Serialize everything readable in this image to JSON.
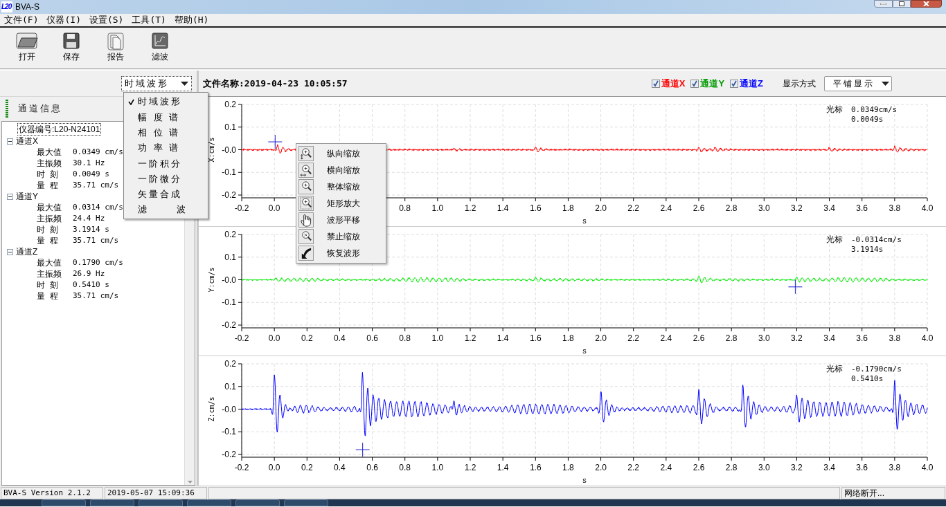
{
  "window": {
    "title": "BVA-S",
    "app_icon_text": "L20"
  },
  "menu": [
    "文件(F)",
    "仪器(I)",
    "设置(S)",
    "工具(T)",
    "帮助(H)"
  ],
  "toolbar": [
    {
      "label": "打开",
      "kind": "open"
    },
    {
      "label": "保存",
      "kind": "save"
    },
    {
      "label": "报告",
      "kind": "report"
    },
    {
      "label": "滤波",
      "kind": "filter"
    }
  ],
  "view_select": {
    "value": "时域波形"
  },
  "view_menu": [
    {
      "label": "时域波形",
      "selected": true
    },
    {
      "label": "幅 度 谱",
      "selected": false
    },
    {
      "label": "相 位 谱",
      "selected": false
    },
    {
      "label": "功 率 谱",
      "selected": false
    },
    {
      "label": "一阶积分",
      "selected": false
    },
    {
      "label": "一阶微分",
      "selected": false
    },
    {
      "label": "矢量合成",
      "selected": false
    },
    {
      "label": "滤      波",
      "selected": false
    }
  ],
  "channel_info": {
    "title": "通道信息",
    "device_id": {
      "label": "仪器编号:L20-N24101",
      "selected": true
    },
    "channels": [
      {
        "label": "通道X",
        "expanded": true,
        "children": [
          {
            "label": "最大值",
            "value": "0.0349 cm/s"
          },
          {
            "label": "主振频",
            "value": "30.1 Hz"
          },
          {
            "label": "时  刻",
            "value": "0.0049 s"
          },
          {
            "label": "量  程",
            "value": "35.71 cm/s"
          }
        ]
      },
      {
        "label": "通道Y",
        "expanded": true,
        "children": [
          {
            "label": "最大值",
            "value": "0.0314 cm/s"
          },
          {
            "label": "主振频",
            "value": "24.4 Hz"
          },
          {
            "label": "时  刻",
            "value": "3.1914 s"
          },
          {
            "label": "量  程",
            "value": "35.71 cm/s"
          }
        ]
      },
      {
        "label": "通道Z",
        "expanded": true,
        "children": [
          {
            "label": "最大值",
            "value": "0.1790 cm/s"
          },
          {
            "label": "主振频",
            "value": "26.9 Hz"
          },
          {
            "label": "时  刻",
            "value": "0.5410 s"
          },
          {
            "label": "量  程",
            "value": "35.71 cm/s"
          }
        ]
      }
    ]
  },
  "file_name": "文件名称:2019-04-23 10:05:57",
  "channel_toggles": [
    {
      "label": "通道X",
      "checked": true,
      "color": "#ff0000"
    },
    {
      "label": "通道Y",
      "checked": true,
      "color": "#009900"
    },
    {
      "label": "通道Z",
      "checked": true,
      "color": "#0000ff"
    }
  ],
  "display_mode": {
    "label": "显示方式",
    "value": "平铺显示"
  },
  "charts": [
    {
      "ylabel": "X:cm/s",
      "xlabel": "s",
      "color": "#ff0000",
      "cursor": {
        "label": "光标",
        "value": "0.0349cm/s",
        "time": "0.0049s"
      },
      "y_tick_labels": [
        "0.2",
        "0.1",
        "-0.0",
        "-0.1",
        "-0.2"
      ],
      "x_tick_labels": [
        "-0.2",
        "0.0",
        "0.8",
        "1.0",
        "1.2",
        "1.4",
        "1.6",
        "1.8",
        "2.0",
        "2.2",
        "2.4",
        "2.6",
        "2.8",
        "3.0",
        "3.2",
        "3.4",
        "3.6",
        "3.8",
        "4.0"
      ]
    },
    {
      "ylabel": "Y:cm/s",
      "xlabel": "s",
      "color": "#00ee00",
      "cursor": {
        "label": "光标",
        "value": "-0.0314cm/s",
        "time": "3.1914s"
      },
      "y_tick_labels": [
        "0.2",
        "0.1",
        "-0.0",
        "-0.1",
        "-0.2"
      ],
      "x_tick_labels": [
        "-0.2",
        "0.0",
        "0.2",
        "0.4",
        "0.6",
        "0.8",
        "1.0",
        "1.2",
        "1.4",
        "1.6",
        "1.8",
        "2.0",
        "2.2",
        "2.4",
        "2.6",
        "2.8",
        "3.0",
        "3.2",
        "3.4",
        "3.6",
        "3.8",
        "4.0"
      ]
    },
    {
      "ylabel": "Z:cm/s",
      "xlabel": "s",
      "color": "#0000ff",
      "cursor": {
        "label": "光标",
        "value": "-0.1790cm/s",
        "time": "0.5410s"
      },
      "y_tick_labels": [
        "0.2",
        "0.1",
        "-0.0",
        "-0.1",
        "-0.2"
      ],
      "x_tick_labels": [
        "-0.2",
        "0.0",
        "0.2",
        "0.4",
        "0.6",
        "0.8",
        "1.0",
        "1.2",
        "1.4",
        "1.6",
        "1.8",
        "2.0",
        "2.2",
        "2.4",
        "2.6",
        "2.8",
        "3.0",
        "3.2",
        "3.4",
        "3.6",
        "3.8",
        "4.0"
      ]
    }
  ],
  "context_menu": [
    {
      "label": "纵向缩放",
      "kind": "zoom-vertical"
    },
    {
      "label": "横向缩放",
      "kind": "zoom-horizontal"
    },
    {
      "label": "整体缩放",
      "kind": "zoom"
    },
    {
      "label": "矩形放大",
      "kind": "zoom-rect"
    },
    {
      "label": "波形平移",
      "kind": "pan"
    },
    {
      "label": "禁止缩放",
      "kind": "zoom-off"
    },
    {
      "label": "恢复波形",
      "kind": "restore"
    }
  ],
  "status_bar": [
    "BVA-S Version 2.1.2",
    "2019-05-07 15:09:36",
    "网络断开..."
  ]
}
